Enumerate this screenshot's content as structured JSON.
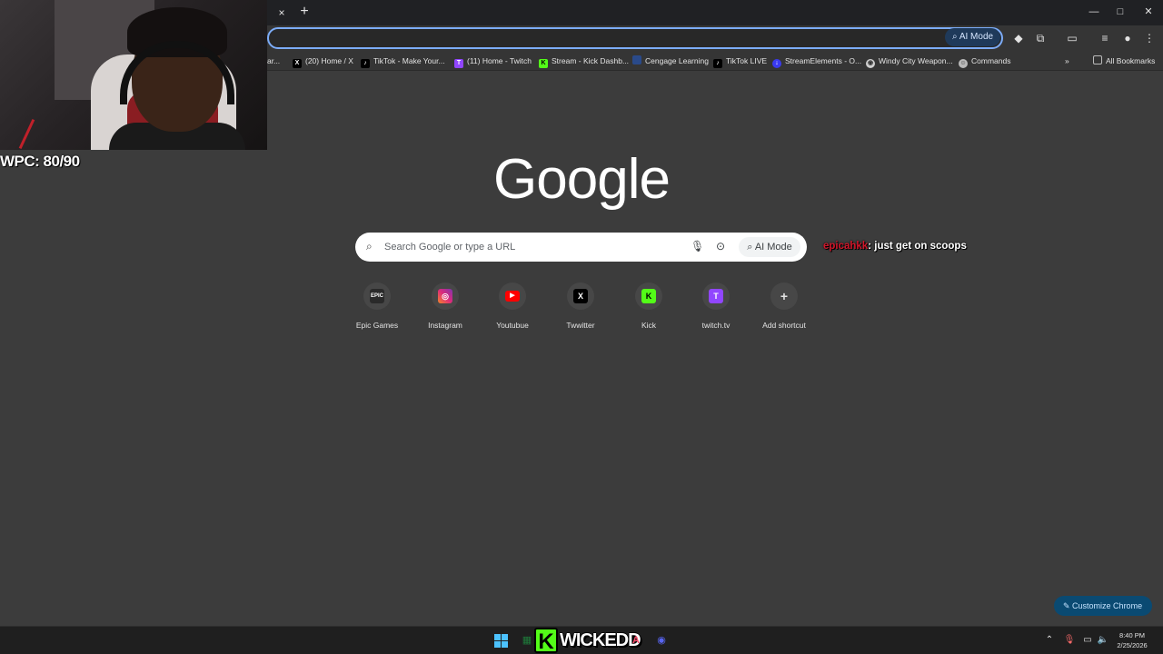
{
  "browser": {
    "tab_close": "×",
    "new_tab": "+",
    "window_controls": {
      "minimize": "—",
      "maximize": "□",
      "close": "✕"
    },
    "omnibox_ai_mode": "AI Mode",
    "bookmarks": [
      {
        "icon": "partial-icon",
        "label": "ar..."
      },
      {
        "icon": "x-icon",
        "label": "(20) Home / X"
      },
      {
        "icon": "tiktok-icon",
        "label": "TikTok - Make Your..."
      },
      {
        "icon": "twitch-icon",
        "label": "(11) Home - Twitch"
      },
      {
        "icon": "kick-icon",
        "label": "Stream - Kick Dashb..."
      },
      {
        "icon": "cengage-icon",
        "label": "Cengage Learning"
      },
      {
        "icon": "tiktok-icon",
        "label": "TikTok LIVE"
      },
      {
        "icon": "streamelements-icon",
        "label": "StreamElements - O..."
      },
      {
        "icon": "globe-icon",
        "label": "Windy City Weapon..."
      },
      {
        "icon": "commands-icon",
        "label": "Commands"
      }
    ],
    "bookmarks_overflow": "»",
    "all_bookmarks": "All Bookmarks"
  },
  "stream_overlay": {
    "wpc": "WPC: 80/90",
    "chat_user": "epicahkk",
    "chat_message": ": just get on scoops",
    "branding": {
      "k": "K",
      "name": "WICKEDD"
    }
  },
  "google": {
    "logo": "Google",
    "search_placeholder": "Search Google or type a URL",
    "ai_mode": "AI Mode",
    "shortcuts": [
      {
        "label": "Epic Games",
        "icon": "epic-games-icon",
        "glyph": "EPIC"
      },
      {
        "label": "Instagram",
        "icon": "instagram-icon",
        "glyph": "◎"
      },
      {
        "label": "Youtubue",
        "icon": "youtube-icon",
        "glyph": "▶"
      },
      {
        "label": "Twwitter",
        "icon": "x-icon",
        "glyph": "X"
      },
      {
        "label": "Kick",
        "icon": "kick-icon",
        "glyph": "K"
      },
      {
        "label": "twitch.tv",
        "icon": "twitch-icon",
        "glyph": "T"
      },
      {
        "label": "Add shortcut",
        "icon": "plus-icon",
        "glyph": "+"
      }
    ],
    "customize": "Customize Chrome"
  },
  "taskbar": {
    "time": "8:40 PM",
    "date": "2/25/2026"
  },
  "colors": {
    "page_bg": "#3c3c3c",
    "kick_green": "#53fc18",
    "chat_user": "#d1162a",
    "customize_bg": "#0a4a72"
  }
}
